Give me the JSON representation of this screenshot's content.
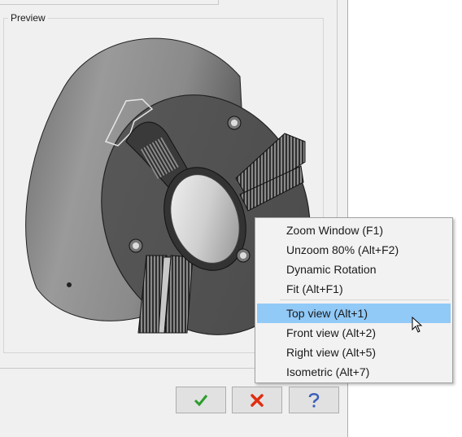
{
  "preview": {
    "label": "Preview"
  },
  "buttons": {
    "ok": {
      "icon": "checkmark-icon",
      "color": "#2a9d2a"
    },
    "cancel": {
      "icon": "x-icon",
      "color": "#e02d10"
    },
    "help": {
      "icon": "question-icon",
      "color": "#3b5fb8"
    }
  },
  "context_menu": {
    "items": [
      {
        "label": "Zoom Window (F1)"
      },
      {
        "label": "Unzoom 80% (Alt+F2)"
      },
      {
        "label": "Dynamic Rotation"
      },
      {
        "label": "Fit (Alt+F1)"
      },
      {
        "label": "Top view (Alt+1)",
        "highlighted": true
      },
      {
        "label": "Front view (Alt+2)"
      },
      {
        "label": "Right view (Alt+5)"
      },
      {
        "label": "Isometric (Alt+7)"
      }
    ],
    "highlight_color": "#91c9f7"
  }
}
